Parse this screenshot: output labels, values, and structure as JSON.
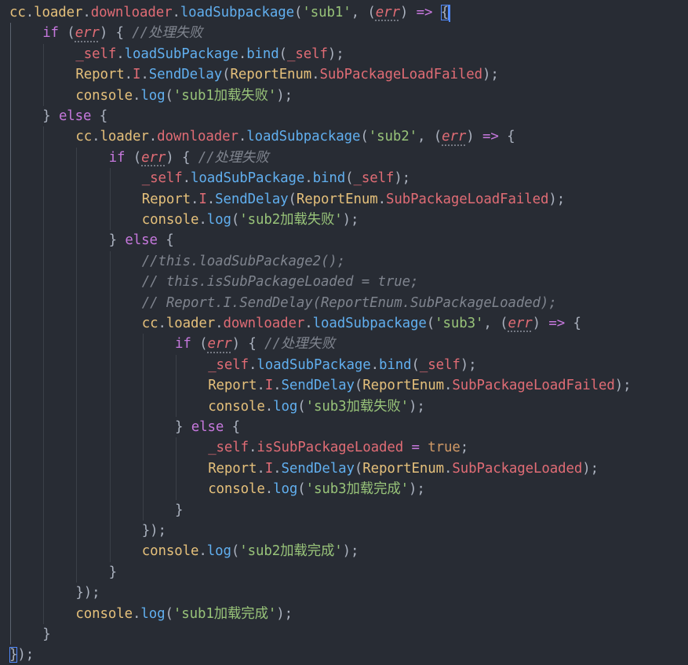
{
  "editor": {
    "colors": {
      "background": "#282c34",
      "identifier": "#e5c07b",
      "method": "#61afef",
      "property": "#e06c75",
      "keyword": "#c678dd",
      "string": "#98c379",
      "comment": "#7f848e",
      "punctuation": "#abb2bf",
      "boolean": "#d19a66"
    },
    "lines": [
      {
        "indent": 0,
        "tokens": [
          [
            "ident",
            "cc"
          ],
          [
            "punct",
            "."
          ],
          [
            "ident",
            "loader"
          ],
          [
            "punct",
            "."
          ],
          [
            "prop",
            "downloader"
          ],
          [
            "punct",
            "."
          ],
          [
            "method",
            "loadSubpackage"
          ],
          [
            "punct",
            "("
          ],
          [
            "string",
            "'sub1'"
          ],
          [
            "punct",
            ", ("
          ],
          [
            "param",
            "err"
          ],
          [
            "punct",
            ") "
          ],
          [
            "operator",
            "=>"
          ],
          [
            "punct",
            " "
          ],
          [
            "brace",
            "{"
          ]
        ]
      },
      {
        "indent": 1,
        "tokens": [
          [
            "keyword",
            "if"
          ],
          [
            "punct",
            " ("
          ],
          [
            "param",
            "err"
          ],
          [
            "punct",
            ") { "
          ],
          [
            "comment",
            "//处理失败"
          ]
        ]
      },
      {
        "indent": 2,
        "tokens": [
          [
            "prop",
            "_self"
          ],
          [
            "punct",
            "."
          ],
          [
            "method",
            "loadSubPackage"
          ],
          [
            "punct",
            "."
          ],
          [
            "method",
            "bind"
          ],
          [
            "punct",
            "("
          ],
          [
            "prop",
            "_self"
          ],
          [
            "punct",
            ");"
          ]
        ]
      },
      {
        "indent": 2,
        "tokens": [
          [
            "ident",
            "Report"
          ],
          [
            "punct",
            "."
          ],
          [
            "prop",
            "I"
          ],
          [
            "punct",
            "."
          ],
          [
            "method",
            "SendDelay"
          ],
          [
            "punct",
            "("
          ],
          [
            "ident",
            "ReportEnum"
          ],
          [
            "punct",
            "."
          ],
          [
            "prop",
            "SubPackageLoadFailed"
          ],
          [
            "punct",
            ");"
          ]
        ]
      },
      {
        "indent": 2,
        "tokens": [
          [
            "ident",
            "console"
          ],
          [
            "punct",
            "."
          ],
          [
            "method",
            "log"
          ],
          [
            "punct",
            "("
          ],
          [
            "string",
            "'sub1加载失败'"
          ],
          [
            "punct",
            ");"
          ]
        ]
      },
      {
        "indent": 1,
        "tokens": [
          [
            "punct",
            "} "
          ],
          [
            "keyword",
            "else"
          ],
          [
            "punct",
            " {"
          ]
        ]
      },
      {
        "indent": 2,
        "tokens": [
          [
            "ident",
            "cc"
          ],
          [
            "punct",
            "."
          ],
          [
            "ident",
            "loader"
          ],
          [
            "punct",
            "."
          ],
          [
            "prop",
            "downloader"
          ],
          [
            "punct",
            "."
          ],
          [
            "method",
            "loadSubpackage"
          ],
          [
            "punct",
            "("
          ],
          [
            "string",
            "'sub2'"
          ],
          [
            "punct",
            ", ("
          ],
          [
            "param",
            "err"
          ],
          [
            "punct",
            ") "
          ],
          [
            "operator",
            "=>"
          ],
          [
            "punct",
            " {"
          ]
        ]
      },
      {
        "indent": 3,
        "tokens": [
          [
            "keyword",
            "if"
          ],
          [
            "punct",
            " ("
          ],
          [
            "param",
            "err"
          ],
          [
            "punct",
            ") { "
          ],
          [
            "comment",
            "//处理失败"
          ]
        ]
      },
      {
        "indent": 4,
        "tokens": [
          [
            "prop",
            "_self"
          ],
          [
            "punct",
            "."
          ],
          [
            "method",
            "loadSubPackage"
          ],
          [
            "punct",
            "."
          ],
          [
            "method",
            "bind"
          ],
          [
            "punct",
            "("
          ],
          [
            "prop",
            "_self"
          ],
          [
            "punct",
            ");"
          ]
        ]
      },
      {
        "indent": 4,
        "tokens": [
          [
            "ident",
            "Report"
          ],
          [
            "punct",
            "."
          ],
          [
            "prop",
            "I"
          ],
          [
            "punct",
            "."
          ],
          [
            "method",
            "SendDelay"
          ],
          [
            "punct",
            "("
          ],
          [
            "ident",
            "ReportEnum"
          ],
          [
            "punct",
            "."
          ],
          [
            "prop",
            "SubPackageLoadFailed"
          ],
          [
            "punct",
            ");"
          ]
        ]
      },
      {
        "indent": 4,
        "tokens": [
          [
            "ident",
            "console"
          ],
          [
            "punct",
            "."
          ],
          [
            "method",
            "log"
          ],
          [
            "punct",
            "("
          ],
          [
            "string",
            "'sub2加载失败'"
          ],
          [
            "punct",
            ");"
          ]
        ]
      },
      {
        "indent": 3,
        "tokens": [
          [
            "punct",
            "} "
          ],
          [
            "keyword",
            "else"
          ],
          [
            "punct",
            " {"
          ]
        ]
      },
      {
        "indent": 4,
        "tokens": [
          [
            "comment",
            "//this.loadSubPackage2();"
          ]
        ]
      },
      {
        "indent": 4,
        "tokens": [
          [
            "comment",
            "// this.isSubPackageLoaded = true;"
          ]
        ]
      },
      {
        "indent": 4,
        "tokens": [
          [
            "comment",
            "// Report.I.SendDelay(ReportEnum.SubPackageLoaded);"
          ]
        ]
      },
      {
        "indent": 4,
        "tokens": [
          [
            "ident",
            "cc"
          ],
          [
            "punct",
            "."
          ],
          [
            "ident",
            "loader"
          ],
          [
            "punct",
            "."
          ],
          [
            "prop",
            "downloader"
          ],
          [
            "punct",
            "."
          ],
          [
            "method",
            "loadSubpackage"
          ],
          [
            "punct",
            "("
          ],
          [
            "string",
            "'sub3'"
          ],
          [
            "punct",
            ", ("
          ],
          [
            "param",
            "err"
          ],
          [
            "punct",
            ") "
          ],
          [
            "operator",
            "=>"
          ],
          [
            "punct",
            " {"
          ]
        ]
      },
      {
        "indent": 5,
        "tokens": [
          [
            "keyword",
            "if"
          ],
          [
            "punct",
            " ("
          ],
          [
            "param",
            "err"
          ],
          [
            "punct",
            ") { "
          ],
          [
            "comment",
            "//处理失败"
          ]
        ]
      },
      {
        "indent": 6,
        "tokens": [
          [
            "prop",
            "_self"
          ],
          [
            "punct",
            "."
          ],
          [
            "method",
            "loadSubPackage"
          ],
          [
            "punct",
            "."
          ],
          [
            "method",
            "bind"
          ],
          [
            "punct",
            "("
          ],
          [
            "prop",
            "_self"
          ],
          [
            "punct",
            ");"
          ]
        ]
      },
      {
        "indent": 6,
        "tokens": [
          [
            "ident",
            "Report"
          ],
          [
            "punct",
            "."
          ],
          [
            "prop",
            "I"
          ],
          [
            "punct",
            "."
          ],
          [
            "method",
            "SendDelay"
          ],
          [
            "punct",
            "("
          ],
          [
            "ident",
            "ReportEnum"
          ],
          [
            "punct",
            "."
          ],
          [
            "prop",
            "SubPackageLoadFailed"
          ],
          [
            "punct",
            ");"
          ]
        ]
      },
      {
        "indent": 6,
        "tokens": [
          [
            "ident",
            "console"
          ],
          [
            "punct",
            "."
          ],
          [
            "method",
            "log"
          ],
          [
            "punct",
            "("
          ],
          [
            "string",
            "'sub3加载失败'"
          ],
          [
            "punct",
            ");"
          ]
        ]
      },
      {
        "indent": 5,
        "tokens": [
          [
            "punct",
            "} "
          ],
          [
            "keyword",
            "else"
          ],
          [
            "punct",
            " {"
          ]
        ]
      },
      {
        "indent": 6,
        "tokens": [
          [
            "prop",
            "_self"
          ],
          [
            "punct",
            "."
          ],
          [
            "prop",
            "isSubPackageLoaded"
          ],
          [
            "punct",
            " "
          ],
          [
            "operator",
            "="
          ],
          [
            "punct",
            " "
          ],
          [
            "bool",
            "true"
          ],
          [
            "punct",
            ";"
          ]
        ]
      },
      {
        "indent": 6,
        "tokens": [
          [
            "ident",
            "Report"
          ],
          [
            "punct",
            "."
          ],
          [
            "prop",
            "I"
          ],
          [
            "punct",
            "."
          ],
          [
            "method",
            "SendDelay"
          ],
          [
            "punct",
            "("
          ],
          [
            "ident",
            "ReportEnum"
          ],
          [
            "punct",
            "."
          ],
          [
            "prop",
            "SubPackageLoaded"
          ],
          [
            "punct",
            ");"
          ]
        ]
      },
      {
        "indent": 6,
        "tokens": [
          [
            "ident",
            "console"
          ],
          [
            "punct",
            "."
          ],
          [
            "method",
            "log"
          ],
          [
            "punct",
            "("
          ],
          [
            "string",
            "'sub3加载完成'"
          ],
          [
            "punct",
            ");"
          ]
        ]
      },
      {
        "indent": 5,
        "tokens": [
          [
            "punct",
            "}"
          ]
        ]
      },
      {
        "indent": 4,
        "tokens": [
          [
            "punct",
            "});"
          ]
        ]
      },
      {
        "indent": 4,
        "tokens": [
          [
            "ident",
            "console"
          ],
          [
            "punct",
            "."
          ],
          [
            "method",
            "log"
          ],
          [
            "punct",
            "("
          ],
          [
            "string",
            "'sub2加载完成'"
          ],
          [
            "punct",
            ");"
          ]
        ]
      },
      {
        "indent": 3,
        "tokens": [
          [
            "punct",
            "}"
          ]
        ]
      },
      {
        "indent": 2,
        "tokens": [
          [
            "punct",
            "});"
          ]
        ]
      },
      {
        "indent": 2,
        "tokens": [
          [
            "ident",
            "console"
          ],
          [
            "punct",
            "."
          ],
          [
            "method",
            "log"
          ],
          [
            "punct",
            "("
          ],
          [
            "string",
            "'sub1加载完成'"
          ],
          [
            "punct",
            ");"
          ]
        ]
      },
      {
        "indent": 1,
        "tokens": [
          [
            "punct",
            "}"
          ]
        ]
      },
      {
        "indent": 0,
        "tokens": [
          [
            "brace",
            "}"
          ],
          [
            "punct",
            ");"
          ]
        ]
      }
    ]
  }
}
